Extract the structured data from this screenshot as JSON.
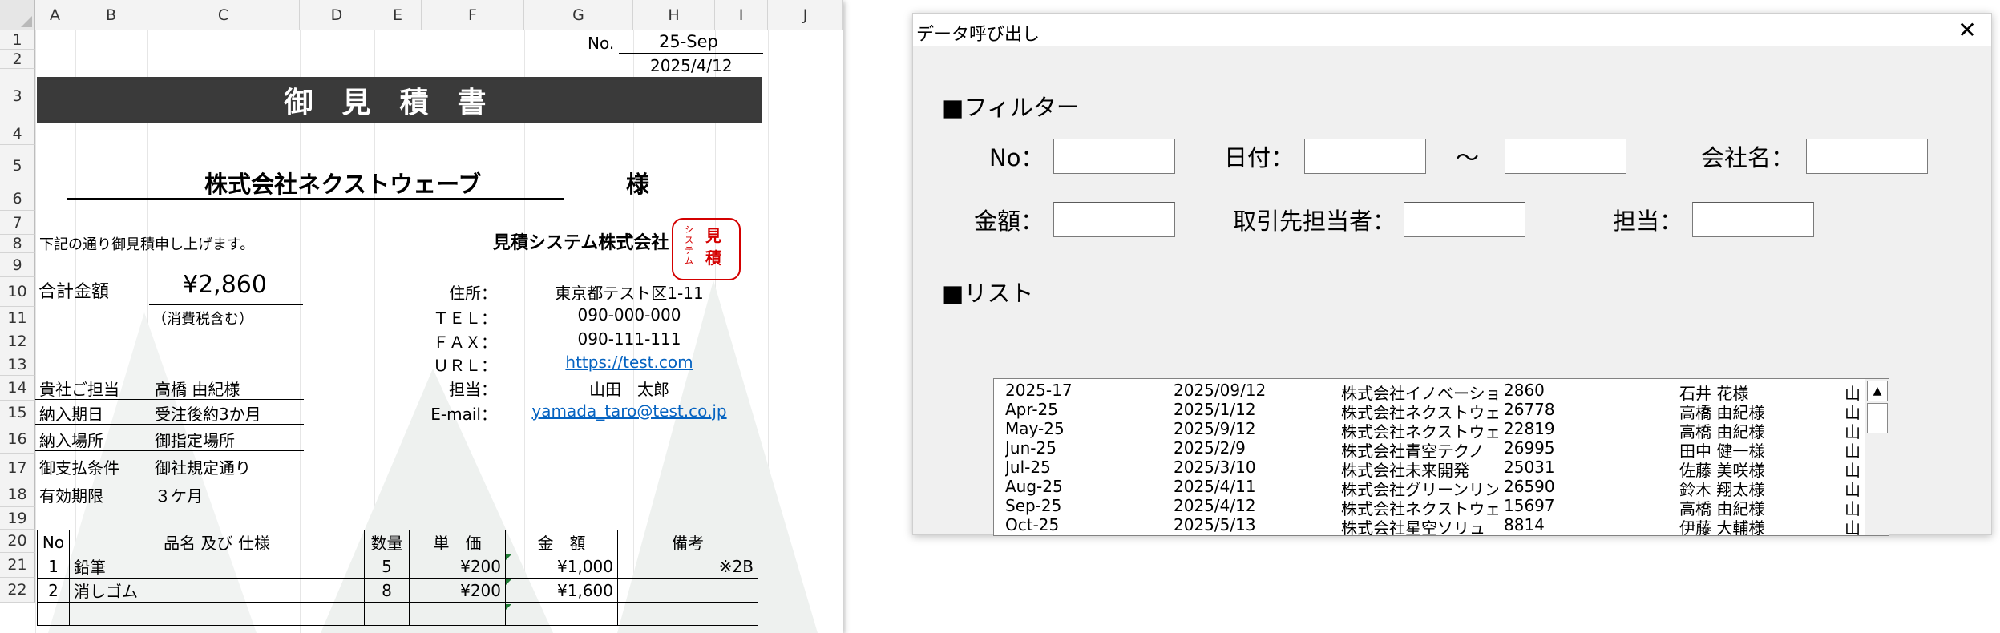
{
  "spreadsheet": {
    "columns": [
      "A",
      "B",
      "C",
      "D",
      "E",
      "F",
      "G",
      "H",
      "I",
      "J"
    ],
    "rows": [
      "1",
      "2",
      "3",
      "4",
      "5",
      "6",
      "7",
      "8",
      "9",
      "10",
      "11",
      "12",
      "13",
      "14",
      "15",
      "16",
      "17",
      "18",
      "19",
      "20",
      "21",
      "22"
    ],
    "no_label": "No.",
    "no_value": "25-Sep",
    "date": "2025/4/12",
    "title": "御見積書",
    "customer": "株式会社ネクストウェーブ",
    "honorific": "様",
    "intro": "下記の通り御見積申し上げます。",
    "company": "見積システム株式会社",
    "seal_left": "システム",
    "seal_right": "見積",
    "total_label": "合計金額",
    "total_value": "¥2,860",
    "tax_note": "（消費税含む）",
    "info_rows": [
      {
        "label": "住所：",
        "value": "東京都テスト区1-11"
      },
      {
        "label": "ＴＥＬ：",
        "value": "090-000-000"
      },
      {
        "label": "ＦＡＸ：",
        "value": "090-111-111"
      },
      {
        "label": "ＵＲＬ：",
        "value": "https://test.com"
      },
      {
        "label": "担当：",
        "value": "山田　太郎"
      },
      {
        "label": "E-mail：",
        "value": "yamada_taro@test.co.jp"
      }
    ],
    "conditions": [
      {
        "label": "貴社ご担当",
        "value": "高橋 由紀様"
      },
      {
        "label": "納入期日",
        "value": "受注後約3か月"
      },
      {
        "label": "納入場所",
        "value": "御指定場所"
      },
      {
        "label": "御支払条件",
        "value": "御社規定通り"
      },
      {
        "label": "有効期限",
        "value": "３ケ月"
      }
    ],
    "table_headers": [
      "No",
      "品名 及び 仕様",
      "数量",
      "単　価",
      "金　額",
      "備考"
    ],
    "items": [
      {
        "no": "1",
        "name": "鉛筆",
        "qty": "5",
        "price": "¥200",
        "amount": "¥1,000",
        "note": "※2B"
      },
      {
        "no": "2",
        "name": "消しゴム",
        "qty": "8",
        "price": "¥200",
        "amount": "¥1,600",
        "note": ""
      }
    ]
  },
  "dialog": {
    "title": "データ呼び出し",
    "close_symbol": "✕",
    "filter_heading": "■フィルター",
    "list_heading": "■リスト",
    "labels": {
      "no": "No：",
      "date": "日付：",
      "tilde": "～",
      "company": "会社名：",
      "amount": "金額：",
      "contact": "取引先担当者：",
      "staff": "担当："
    },
    "fields": {
      "no": "",
      "date_from": "",
      "date_to": "",
      "company": "",
      "amount": "",
      "contact": "",
      "staff": ""
    },
    "list_rows": [
      {
        "no": "2025-17",
        "date": "2025/09/12",
        "company": "株式会社イノベーショ",
        "amount": "2860",
        "contact": "石井 花様",
        "staff": "山"
      },
      {
        "no": "Apr-25",
        "date": "2025/1/12",
        "company": "株式会社ネクストウェ",
        "amount": "26778",
        "contact": "高橋 由紀様",
        "staff": "山"
      },
      {
        "no": "May-25",
        "date": "2025/9/12",
        "company": "株式会社ネクストウェ",
        "amount": "22819",
        "contact": "高橋 由紀様",
        "staff": "山"
      },
      {
        "no": "Jun-25",
        "date": "2025/2/9",
        "company": "株式会社青空テクノ",
        "amount": "26995",
        "contact": "田中 健一様",
        "staff": "山"
      },
      {
        "no": "Jul-25",
        "date": "2025/3/10",
        "company": "株式会社未来開発",
        "amount": "25031",
        "contact": "佐藤 美咲様",
        "staff": "山"
      },
      {
        "no": "Aug-25",
        "date": "2025/4/11",
        "company": "株式会社グリーンリン",
        "amount": "26590",
        "contact": "鈴木 翔太様",
        "staff": "山"
      },
      {
        "no": "Sep-25",
        "date": "2025/4/12",
        "company": "株式会社ネクストウェ",
        "amount": "15697",
        "contact": "高橋 由紀様",
        "staff": "山"
      },
      {
        "no": "Oct-25",
        "date": "2025/5/13",
        "company": "株式会社星空ソリュ",
        "amount": "8814",
        "contact": "伊藤 大輔様",
        "staff": "山"
      }
    ]
  }
}
